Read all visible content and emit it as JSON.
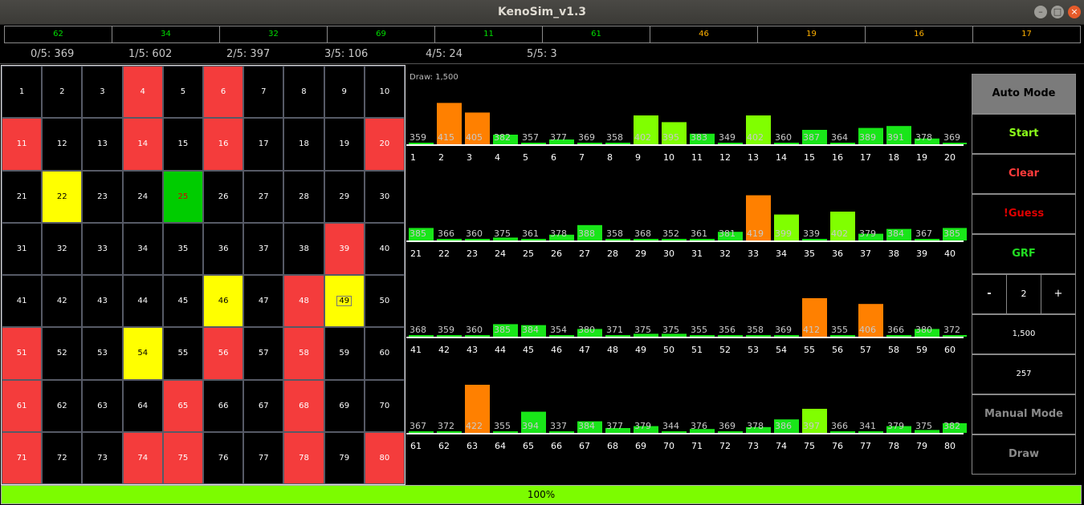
{
  "window": {
    "title": "KenoSim_v1.3"
  },
  "last_draw": [
    {
      "num": "62",
      "color": "#00dd00"
    },
    {
      "num": "34",
      "color": "#00dd00"
    },
    {
      "num": "32",
      "color": "#00dd00"
    },
    {
      "num": "69",
      "color": "#00dd00"
    },
    {
      "num": "11",
      "color": "#00dd00"
    },
    {
      "num": "61",
      "color": "#00dd00"
    },
    {
      "num": "46",
      "color": "#ffb000"
    },
    {
      "num": "19",
      "color": "#ffb000"
    },
    {
      "num": "16",
      "color": "#ffb000"
    },
    {
      "num": "17",
      "color": "#ffb000"
    }
  ],
  "stats": [
    {
      "label": "0/5: 369"
    },
    {
      "label": "1/5: 602"
    },
    {
      "label": "2/5: 397"
    },
    {
      "label": "3/5: 106"
    },
    {
      "label": "4/5: 24"
    },
    {
      "label": "5/5: 3"
    }
  ],
  "board": {
    "hit": [
      4,
      6,
      11,
      14,
      16,
      20,
      39,
      48,
      51,
      56,
      58,
      61,
      65,
      68,
      71,
      74,
      75,
      78,
      80
    ],
    "pick": [
      22,
      46,
      49,
      54
    ],
    "boxed": [
      49
    ],
    "match": [
      25
    ]
  },
  "frequency": {
    "draw_label": "Draw: 1,500",
    "values": [
      359,
      415,
      405,
      382,
      357,
      377,
      369,
      358,
      402,
      395,
      383,
      349,
      402,
      360,
      387,
      364,
      389,
      391,
      378,
      369,
      385,
      366,
      360,
      375,
      361,
      378,
      388,
      358,
      368,
      352,
      361,
      381,
      419,
      399,
      339,
      402,
      379,
      384,
      367,
      385,
      368,
      359,
      360,
      385,
      384,
      354,
      380,
      371,
      375,
      375,
      355,
      356,
      358,
      369,
      412,
      355,
      406,
      366,
      380,
      372,
      367,
      372,
      422,
      355,
      394,
      337,
      384,
      377,
      379,
      344,
      376,
      369,
      378,
      386,
      397,
      366,
      341,
      379,
      375,
      382
    ]
  },
  "colors": {
    "orange": "#ff8000",
    "lime": "#80ff00",
    "green": "#19e619"
  },
  "side": {
    "auto_mode": "Auto Mode",
    "start": "Start",
    "clear": "Clear",
    "guess": "!Guess",
    "grf": "GRF",
    "minus": "-",
    "spots": "2",
    "plus": "+",
    "draw_count": "1,500",
    "games": "257",
    "manual_mode": "Manual Mode",
    "draw": "Draw"
  },
  "progress": {
    "value": 1.0,
    "label": "100%"
  }
}
